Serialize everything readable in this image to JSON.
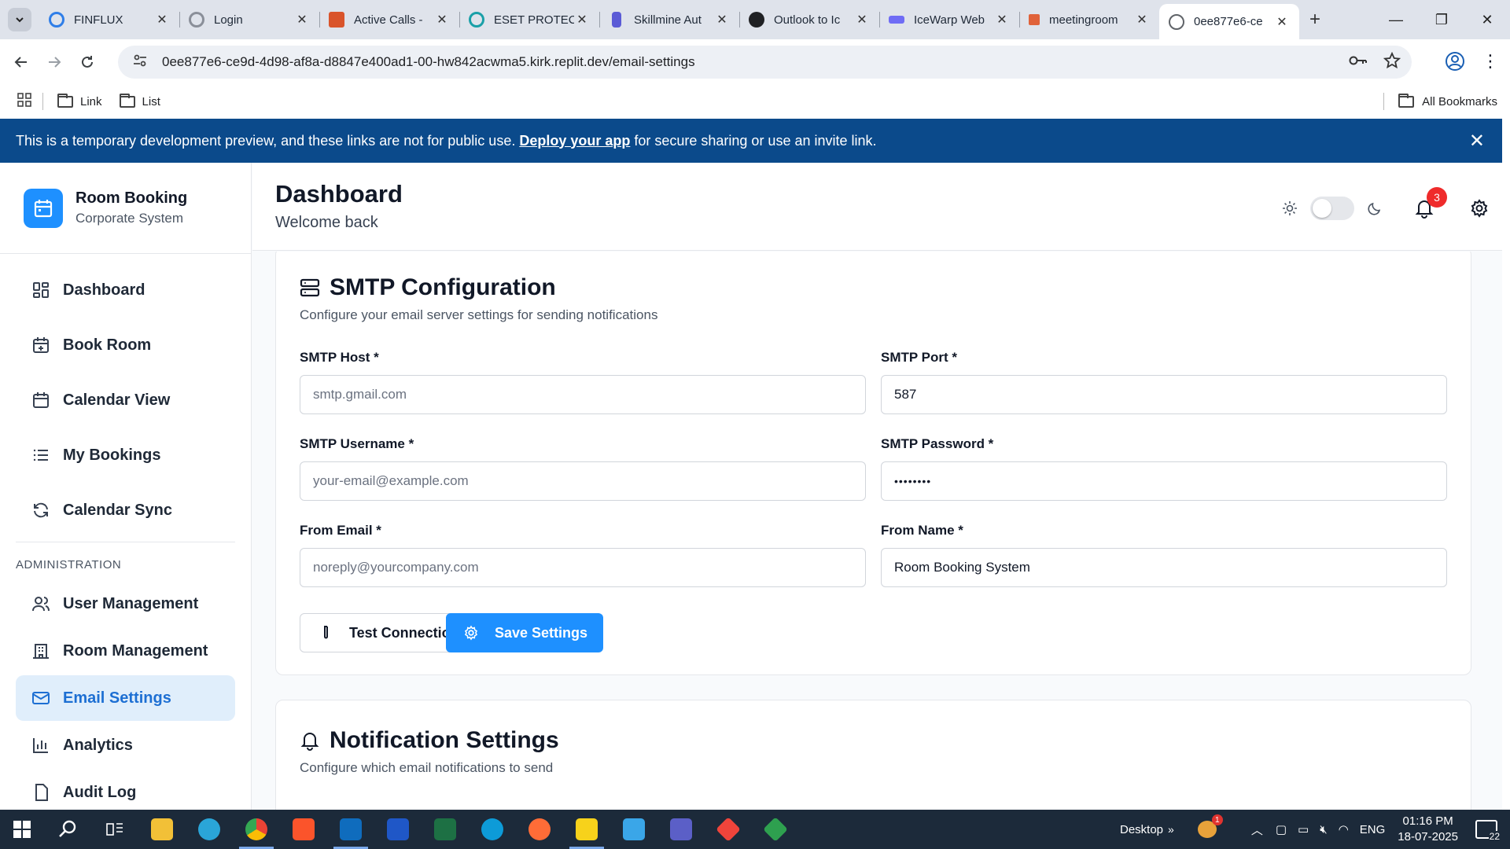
{
  "browser": {
    "tabs": [
      {
        "title": "FINFLUX",
        "color": "#2f7ee8"
      },
      {
        "title": "Login",
        "color": "#8a8f99"
      },
      {
        "title": "Active Calls -",
        "color": "#d9542b"
      },
      {
        "title": "ESET PROTEC",
        "color": "#1aa0a8"
      },
      {
        "title": "Skillmine Aut",
        "color": "#5b5bd6"
      },
      {
        "title": "Outlook to Ic",
        "color": "#202124"
      },
      {
        "title": "IceWarp Web",
        "color": "#6f6cf5"
      },
      {
        "title": "meetingroom",
        "color": "#e0623a"
      },
      {
        "title": "0ee877e6-ce",
        "color": "#5f6368"
      }
    ],
    "url": "0ee877e6-ce9d-4d98-af8a-d8847e400ad1-00-hw842acwma5.kirk.replit.dev/email-settings",
    "bookmarks": [
      "Link",
      "List"
    ],
    "all_bookmarks": "All Bookmarks"
  },
  "banner": {
    "text_before": "This is a temporary development preview, and these links are not for public use.",
    "link": "Deploy your app",
    "text_after": "for secure sharing or use an invite link."
  },
  "sidebar": {
    "brand_title": "Room Booking",
    "brand_subtitle": "Corporate System",
    "items": [
      {
        "label": "Dashboard",
        "icon": "dashboard-icon"
      },
      {
        "label": "Book Room",
        "icon": "calendar-plus-icon"
      },
      {
        "label": "Calendar View",
        "icon": "calendar-icon"
      },
      {
        "label": "My Bookings",
        "icon": "list-icon"
      },
      {
        "label": "Calendar Sync",
        "icon": "refresh-icon"
      }
    ],
    "admin_section": "ADMINISTRATION",
    "admin_items": [
      {
        "label": "User Management",
        "icon": "users-icon"
      },
      {
        "label": "Room Management",
        "icon": "building-icon"
      },
      {
        "label": "Email Settings",
        "icon": "mail-icon",
        "active": true
      },
      {
        "label": "Analytics",
        "icon": "bar-chart-icon"
      },
      {
        "label": "Audit Log",
        "icon": "file-icon"
      }
    ]
  },
  "header": {
    "title": "Dashboard",
    "subtitle": "Welcome back",
    "notification_count": "3"
  },
  "smtp": {
    "title": "SMTP Configuration",
    "description": "Configure your email server settings for sending notifications",
    "host_label": "SMTP Host *",
    "host_placeholder": "smtp.gmail.com",
    "port_label": "SMTP Port *",
    "port_value": "587",
    "username_label": "SMTP Username *",
    "username_placeholder": "your-email@example.com",
    "password_label": "SMTP Password *",
    "password_value": "••••••••",
    "from_email_label": "From Email *",
    "from_email_placeholder": "noreply@yourcompany.com",
    "from_name_label": "From Name *",
    "from_name_value": "Room Booking System",
    "test_button": "Test Connection",
    "save_button": "Save Settings"
  },
  "notifications": {
    "title": "Notification Settings",
    "description": "Configure which email notifications to send"
  },
  "taskbar": {
    "desktop_label": "Desktop",
    "weather_badge": "1",
    "language": "ENG",
    "time": "01:16 PM",
    "date": "18-07-2025",
    "chat_count": "22"
  },
  "colors": {
    "banner": "#0b4a8b",
    "accent": "#1e90ff",
    "active_nav_bg": "#e0eefb",
    "badge": "#ef2b2b"
  }
}
